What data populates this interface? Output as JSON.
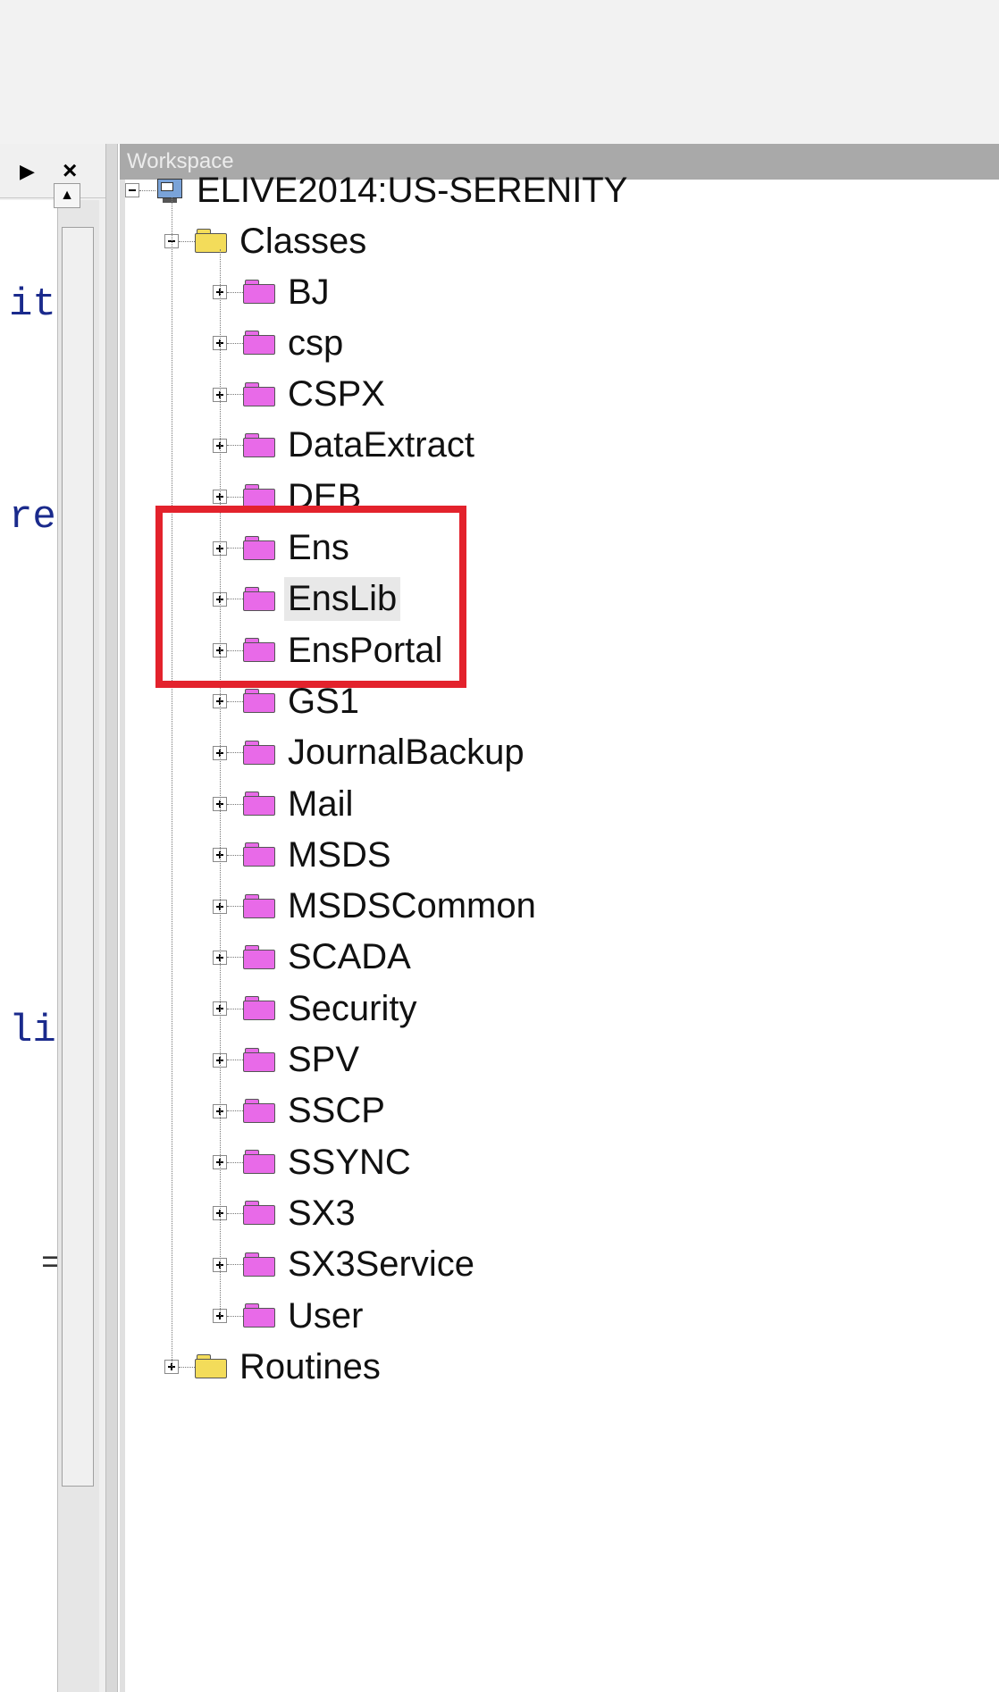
{
  "left_pane": {
    "code_fragments": [
      "it",
      "re",
      "li",
      "="
    ]
  },
  "workspace": {
    "title": "Workspace",
    "root": "ELIVE2014:US-SERENITY",
    "classes_label": "Classes",
    "packages": [
      "BJ",
      "csp",
      "CSPX",
      "DataExtract",
      "DEB",
      "Ens",
      "EnsLib",
      "EnsPortal",
      "GS1",
      "JournalBackup",
      "Mail",
      "MSDS",
      "MSDSCommon",
      "SCADA",
      "Security",
      "SPV",
      "SSCP",
      "SSYNC",
      "SX3",
      "SX3Service",
      "User"
    ],
    "routines_label": "Routines",
    "selected": "EnsLib"
  },
  "colors": {
    "highlight": "#e3222c",
    "folder_class": "#e86ae8",
    "folder_routine": "#f3dc5a",
    "title_bar": "#a9a9a9"
  }
}
